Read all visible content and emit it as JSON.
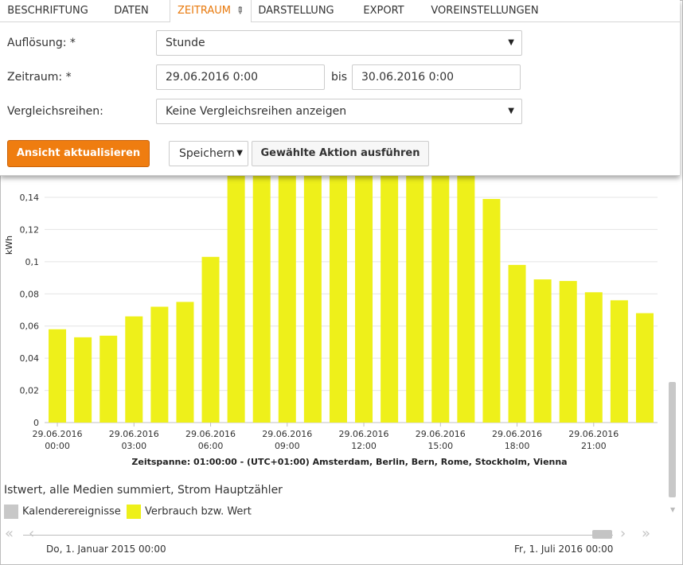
{
  "tabs": [
    "BESCHRIFTUNG",
    "DATEN",
    "ZEITRAUM",
    "DARSTELLUNG",
    "EXPORT",
    "VOREINSTELLUNGEN"
  ],
  "active_tab": "ZEITRAUM",
  "form": {
    "aufloesung_label": "Auflösung: *",
    "aufloesung_value": "Stunde",
    "zeitraum_label": "Zeitraum: *",
    "zeitraum_from": "29.06.2016 0:00",
    "bis_label": "bis",
    "zeitraum_to": "30.06.2016 0:00",
    "vergleich_label": "Vergleichsreihen:",
    "vergleich_value": "Keine Vergleichsreihen anzeigen"
  },
  "actions": {
    "refresh_label": "Ansicht aktualisieren",
    "save_select_value": "Speichern",
    "execute_label": "Gewählte Aktion ausführen"
  },
  "chart_data": {
    "type": "bar",
    "ylabel": "kWh",
    "xlabel": "Zeitspanne: 01:00:00 - (UTC+01:00) Amsterdam, Berlin, Bern, Rome, Stockholm, Vienna",
    "ylim": [
      0,
      0.14
    ],
    "yticks": [
      "0",
      "0,02",
      "0,04",
      "0,06",
      "0,08",
      "0,1",
      "0,12",
      "0,14"
    ],
    "color": "#eef01a",
    "hours": [
      "00:00",
      "01:00",
      "02:00",
      "03:00",
      "04:00",
      "05:00",
      "06:00",
      "07:00",
      "08:00",
      "09:00",
      "10:00",
      "11:00",
      "12:00",
      "13:00",
      "14:00",
      "15:00",
      "16:00",
      "17:00",
      "18:00",
      "19:00",
      "20:00",
      "21:00",
      "22:00",
      "23:00"
    ],
    "values": [
      0.058,
      0.053,
      0.054,
      0.066,
      0.072,
      0.075,
      0.103,
      0.16,
      0.16,
      0.16,
      0.16,
      0.16,
      0.16,
      0.16,
      0.16,
      0.16,
      0.16,
      0.139,
      0.098,
      0.089,
      0.088,
      0.081,
      0.076,
      0.068
    ],
    "x_tick_labels": [
      {
        "date": "29.06.2016",
        "time": "00:00",
        "index": 0
      },
      {
        "date": "29.06.2016",
        "time": "03:00",
        "index": 3
      },
      {
        "date": "29.06.2016",
        "time": "06:00",
        "index": 6
      },
      {
        "date": "29.06.2016",
        "time": "09:00",
        "index": 9
      },
      {
        "date": "29.06.2016",
        "time": "12:00",
        "index": 12
      },
      {
        "date": "29.06.2016",
        "time": "15:00",
        "index": 15
      },
      {
        "date": "29.06.2016",
        "time": "18:00",
        "index": 18
      },
      {
        "date": "29.06.2016",
        "time": "21:00",
        "index": 21
      }
    ]
  },
  "legend": {
    "title": "Istwert, alle Medien summiert, Strom Hauptzähler",
    "items": [
      {
        "label": "Kalenderereignisse",
        "color": "#c8c8c8"
      },
      {
        "label": "Verbrauch bzw. Wert",
        "color": "#eef01a"
      }
    ]
  },
  "navigator": {
    "start_date": "Do, 1. Januar 2015 00:00",
    "end_date": "Fr, 1. Juli 2016 00:00"
  }
}
